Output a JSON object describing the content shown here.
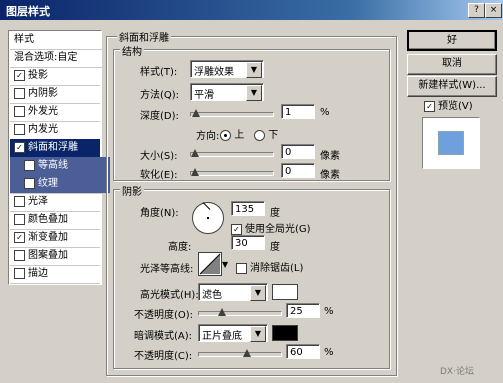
{
  "window": {
    "title": "图层样式",
    "help_btn": "?",
    "close_btn": "×"
  },
  "sidebar": {
    "items": [
      {
        "label": "样式",
        "checkbox": false,
        "checked": false,
        "state": "normal"
      },
      {
        "label": "混合选项:自定",
        "checkbox": false,
        "checked": false,
        "state": "normal"
      },
      {
        "label": "投影",
        "checkbox": true,
        "checked": true,
        "state": "normal"
      },
      {
        "label": "内阴影",
        "checkbox": true,
        "checked": false,
        "state": "normal"
      },
      {
        "label": "外发光",
        "checkbox": true,
        "checked": false,
        "state": "normal"
      },
      {
        "label": "内发光",
        "checkbox": true,
        "checked": false,
        "state": "normal"
      },
      {
        "label": "斜面和浮雕",
        "checkbox": true,
        "checked": true,
        "state": "selected"
      },
      {
        "label": "等高线",
        "checkbox": true,
        "checked": false,
        "state": "sub"
      },
      {
        "label": "纹理",
        "checkbox": true,
        "checked": false,
        "state": "sub"
      },
      {
        "label": "光泽",
        "checkbox": true,
        "checked": false,
        "state": "normal"
      },
      {
        "label": "颜色叠加",
        "checkbox": true,
        "checked": false,
        "state": "normal"
      },
      {
        "label": "渐变叠加",
        "checkbox": true,
        "checked": true,
        "state": "normal"
      },
      {
        "label": "图案叠加",
        "checkbox": true,
        "checked": false,
        "state": "normal"
      },
      {
        "label": "描边",
        "checkbox": true,
        "checked": false,
        "state": "normal"
      }
    ]
  },
  "bevel": {
    "group_title": "斜面和浮雕",
    "structure": {
      "title": "结构",
      "style_label": "样式(T):",
      "style_value": "浮雕效果",
      "technique_label": "方法(Q):",
      "technique_value": "平滑",
      "depth_label": "深度(D):",
      "depth_value": "1",
      "depth_unit": "%",
      "depth_pos": 0.02,
      "direction_label": "方向:",
      "dir_up": "上",
      "dir_down": "下",
      "dir_selected": "up",
      "size_label": "大小(S):",
      "size_value": "0",
      "size_unit": "像素",
      "size_pos": 0.0,
      "soften_label": "软化(E):",
      "soften_value": "0",
      "soften_unit": "像素",
      "soften_pos": 0.0
    },
    "shading": {
      "title": "阴影",
      "angle_label": "角度(N):",
      "angle_value": "135",
      "angle_unit": "度",
      "global_light_label": "使用全局光(G)",
      "global_light_checked": true,
      "altitude_label": "高度:",
      "altitude_value": "30",
      "altitude_unit": "度",
      "gloss_label": "光泽等高线:",
      "antialias_label": "消除锯齿(L)",
      "antialias_checked": false,
      "highlight_label": "高光模式(H):",
      "highlight_mode": "滤色",
      "highlight_color": "#ffffff",
      "hl_opacity_label": "不透明度(O):",
      "hl_opacity_value": "25",
      "hl_opacity_unit": "%",
      "hl_opacity_pos": 0.25,
      "shadow_label": "暗调模式(A):",
      "shadow_mode": "正片叠底",
      "shadow_color": "#000000",
      "sh_opacity_label": "不透明度(C):",
      "sh_opacity_value": "60",
      "sh_opacity_unit": "%",
      "sh_opacity_pos": 0.6
    }
  },
  "buttons": {
    "ok": "好",
    "cancel": "取消",
    "new_style": "新建样式(W)...",
    "preview_label": "预览(V)",
    "preview_checked": true
  },
  "preview": {
    "swatch_color": "#6fa0dd"
  },
  "watermark": "DX·论坛"
}
